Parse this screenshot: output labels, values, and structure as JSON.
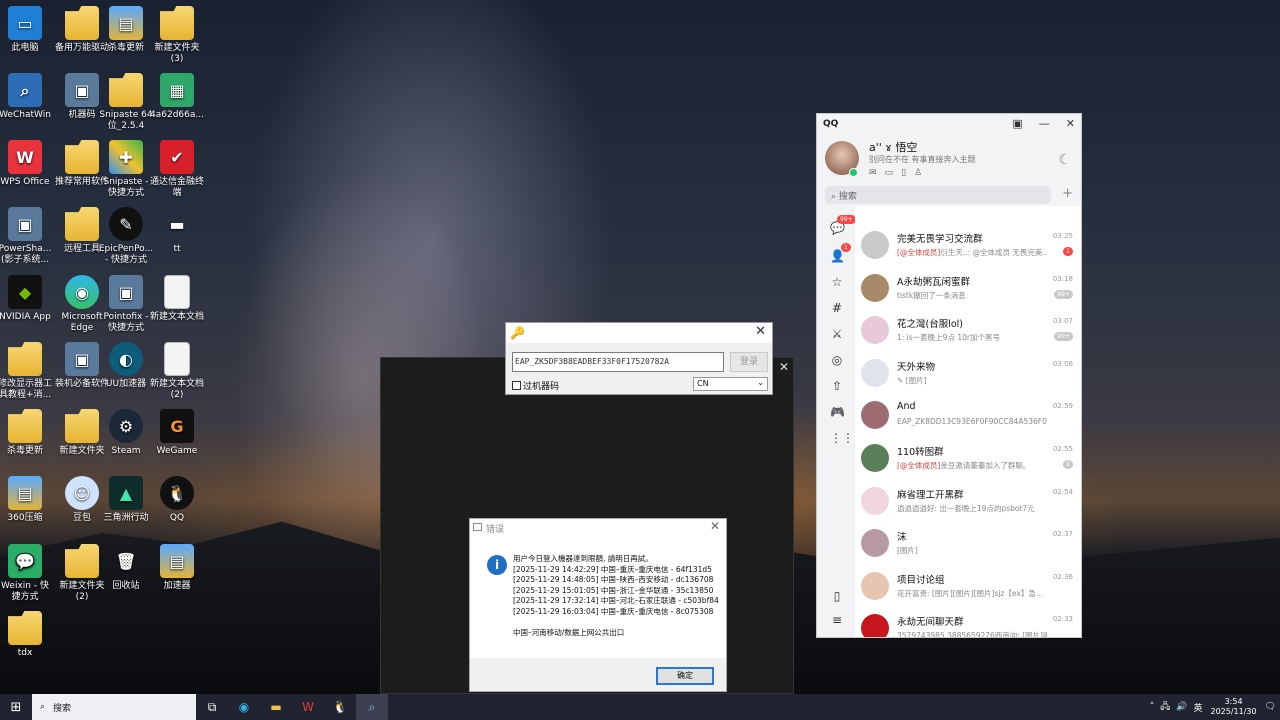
{
  "desktop": {
    "icons": [
      {
        "label": "此电脑",
        "kind": "pc"
      },
      {
        "label": "备用万能驱动",
        "kind": "folder"
      },
      {
        "label": "杀毒更新",
        "kind": "archive"
      },
      {
        "label": "新建文件夹\n(3)",
        "kind": "folder"
      },
      {
        "label": "WeChatWin",
        "kind": "search"
      },
      {
        "label": "机器码",
        "kind": "app"
      },
      {
        "label": "Snipaste 64\n位_2.5.4",
        "kind": "folder"
      },
      {
        "label": "4a62d66a...",
        "kind": "image"
      },
      {
        "label": "WPS Office",
        "kind": "wps"
      },
      {
        "label": "推荐常用软件",
        "kind": "folder"
      },
      {
        "label": "Snipaste -\n快捷方式",
        "kind": "snipaste"
      },
      {
        "label": "通达信金融终\n端",
        "kind": "tdx"
      },
      {
        "label": "PowerSha...\n(影子系统...",
        "kind": "app"
      },
      {
        "label": "远程工具",
        "kind": "folder"
      },
      {
        "label": "EpicPenPo...\n- 快捷方式",
        "kind": "pen"
      },
      {
        "label": "tt",
        "kind": "text"
      },
      {
        "label": "NVIDIA App",
        "kind": "nvidia"
      },
      {
        "label": "Microsoft\nEdge",
        "kind": "edge"
      },
      {
        "label": "Pointofix -\n快捷方式",
        "kind": "app"
      },
      {
        "label": "新建文本文档",
        "kind": "doc"
      },
      {
        "label": "修改显示器工\n具教程+消...",
        "kind": "folder"
      },
      {
        "label": "装机必备软件",
        "kind": "app"
      },
      {
        "label": "UU加速器",
        "kind": "uu"
      },
      {
        "label": "新建文本文档\n(2)",
        "kind": "doc"
      },
      {
        "label": "杀毒更新",
        "kind": "folder"
      },
      {
        "label": "新建文件夹",
        "kind": "folder"
      },
      {
        "label": "Steam",
        "kind": "steam"
      },
      {
        "label": "WeGame",
        "kind": "wegame"
      },
      {
        "label": "360压缩",
        "kind": "archive"
      },
      {
        "label": "豆包",
        "kind": "doubao"
      },
      {
        "label": "三角洲行动",
        "kind": "delta"
      },
      {
        "label": "QQ",
        "kind": "qq"
      },
      {
        "label": "Weixin - 快\n捷方式",
        "kind": "wechat"
      },
      {
        "label": "新建文件夹\n(2)",
        "kind": "folder"
      },
      {
        "label": "回收站",
        "kind": "recycle"
      },
      {
        "label": "加速器",
        "kind": "archive"
      },
      {
        "label": "tdx",
        "kind": "folder"
      }
    ]
  },
  "login_dialog": {
    "code_value": "EAP_ZK5DF3B8EADBEF33F0F17520782A",
    "login_label": "登录",
    "checkbox_label": "过机器码",
    "region_value": "CN"
  },
  "error_dialog": {
    "title": "错误",
    "message": "用户今日登入機器達到限額, 請明日再試。\n[2025-11-29 14:42:29] 中国–重庆–重庆电信 - 64f131d5\n[2025-11-29 14:48:05] 中国–陕西–西安移动 - dc136708\n[2025-11-29 15:01:05] 中国–浙江–金华联通 - 35c13850\n[2025-11-29 17:32:14] 中国–河北–石家庄联通 - c503bf84\n[2025-11-29 16:03:04] 中国–重庆–重庆电信 - 8c075308\n\n中国–河南移动/数据上网公共出口",
    "ok_label": "确定"
  },
  "qq": {
    "title": "QQ",
    "nickname": "a'' ɤ 悟空",
    "status": "别问在不在 有事直接奔入主题",
    "search_placeholder": "搜索",
    "side_badges": {
      "messages": "99+",
      "contacts": "1"
    },
    "chats": [
      {
        "name": "完美无畏学习交流群",
        "time": "03:25",
        "highlight": "[@全体成员]",
        "preview": "衍生天..: @全体成员 无畏完美...",
        "count": "1",
        "red": true
      },
      {
        "name": "A永劫粥瓦闲蜜群",
        "time": "03:18",
        "highlight": "",
        "preview": "tistk撤回了一条消息",
        "count": "99+",
        "red": false
      },
      {
        "name": "花之灣(台服lol)",
        "time": "03:07",
        "highlight": "",
        "preview": "1: is一套晚上9点 10r加个黑号",
        "count": "99+",
        "red": false
      },
      {
        "name": "天外来物",
        "time": "03:06",
        "highlight": "",
        "preview": "✎ [图片]",
        "count": "",
        "red": false
      },
      {
        "name": "And",
        "time": "02:59",
        "highlight": "",
        "preview": "EAP_ZK8DD13C93E6F0F90CC84A536F0E",
        "count": "",
        "red": false
      },
      {
        "name": "110转图群",
        "time": "02:55",
        "highlight": "[@全体成员]",
        "preview": "金豆邀请蓁蓁加入了群聊。",
        "count": "2",
        "red": false
      },
      {
        "name": "麻省理工开黑群",
        "time": "02:54",
        "highlight": "",
        "preview": "逍逍逍逍好: 出一套晚上19点的psbot7元",
        "count": "",
        "red": false
      },
      {
        "name": "沫",
        "time": "02:37",
        "highlight": "",
        "preview": "[图片]",
        "count": "",
        "red": false
      },
      {
        "name": "项目讨论组",
        "time": "02:36",
        "highlight": "",
        "preview": "花开富贵: [图片][图片][图片]sjz【ex】急...",
        "count": "",
        "red": false
      },
      {
        "name": "永劫无间聊天群",
        "time": "02:33",
        "highlight": "",
        "preview": "3579743985 3885659276西南向: [图片]哪个兄弟...",
        "count": "",
        "red": false
      }
    ]
  },
  "taskbar": {
    "search_placeholder": "搜索",
    "ime": "英",
    "time": "3:54",
    "date": "2025/11/30"
  }
}
